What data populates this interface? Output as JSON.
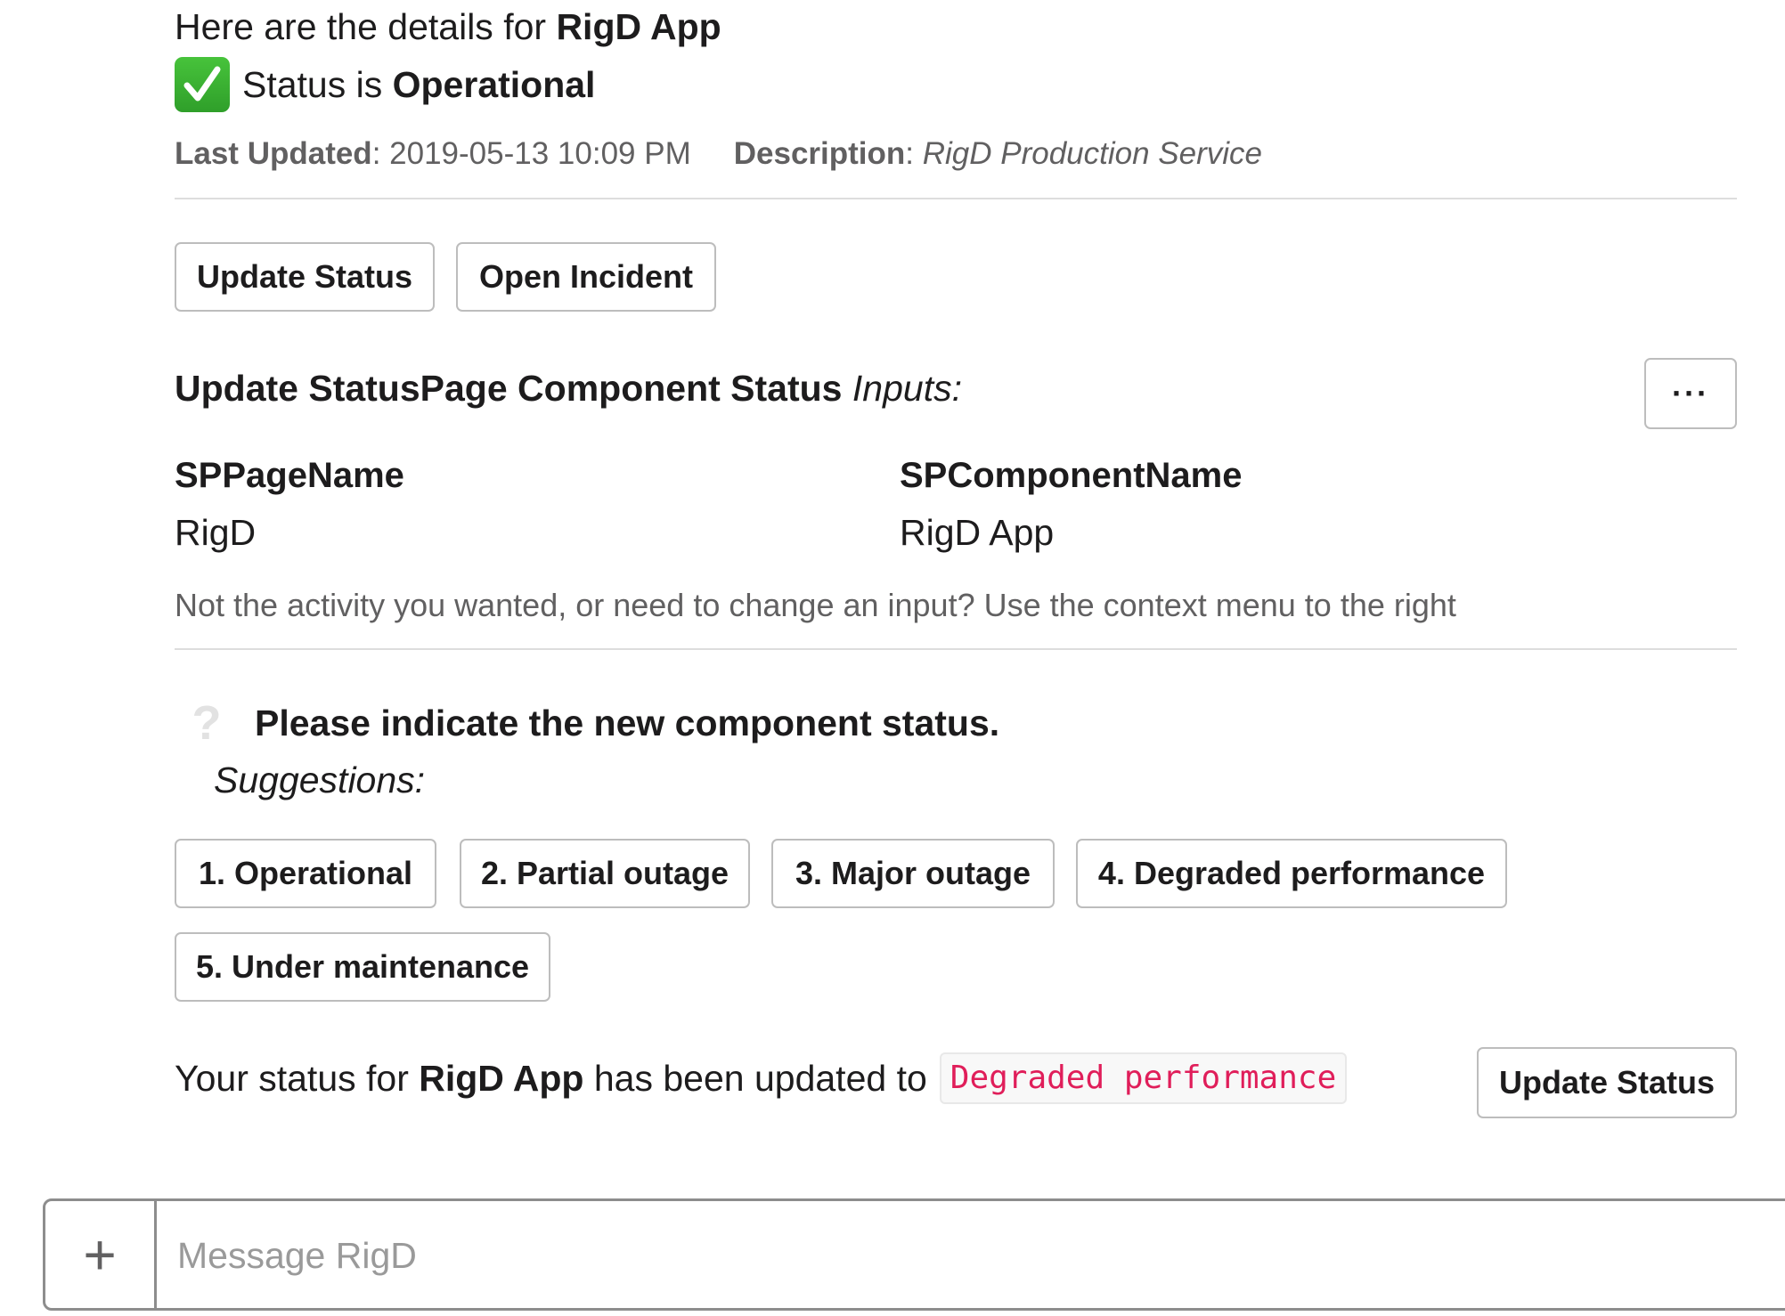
{
  "header": {
    "details_prefix": "Here are the details for ",
    "app_name": "RigD App",
    "status_prefix": "Status is ",
    "status_value": "Operational"
  },
  "meta": {
    "last_updated_label": "Last Updated",
    "last_updated_value": "2019-05-13 10:09 PM",
    "description_label": "Description",
    "description_value": "RigD Production Service"
  },
  "actions": {
    "update_status_label": "Update Status",
    "open_incident_label": "Open Incident"
  },
  "inputs_section": {
    "title": "Update StatusPage Component Status",
    "title_suffix": "Inputs:",
    "more_label": "···",
    "fields": [
      {
        "label": "SPPageName",
        "value": "RigD"
      },
      {
        "label": "SPComponentName",
        "value": "RigD App"
      }
    ],
    "hint": "Not the activity you wanted, or need to change an input? Use the context menu to the right"
  },
  "question": {
    "icon_char": "?",
    "text": "Please indicate the new component status.",
    "suggestions_label": "Suggestions:",
    "options": [
      "1. Operational",
      "2. Partial outage",
      "3. Major outage",
      "4. Degraded performance",
      "5. Under maintenance"
    ]
  },
  "result": {
    "prefix": "Your status for ",
    "app_name": "RigD App",
    "middle": " has been updated to",
    "new_status": "Degraded performance",
    "button_label": "Update Status"
  },
  "composer": {
    "plus_label": "+",
    "placeholder": "Message RigD"
  },
  "colors": {
    "status_code_text": "#e01e5a",
    "check_green": "#3bb33a"
  }
}
